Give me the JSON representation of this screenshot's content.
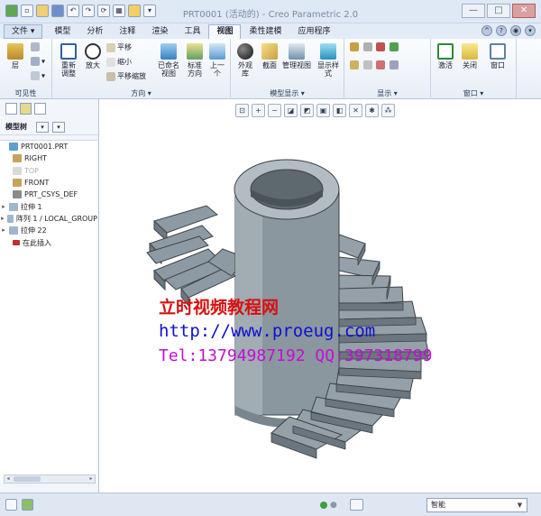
{
  "title_bar": {
    "title": "PRT0001 (活动的) - Creo Parametric 2.0",
    "qat_icons": [
      "new-icon",
      "open-icon",
      "save-icon",
      "undo-icon",
      "redo-icon",
      "regenerate-icon",
      "windows-icon",
      "close-window-icon"
    ],
    "window_buttons": [
      "—",
      "□",
      "✕"
    ]
  },
  "ribbon_tabs": [
    {
      "label": "文件 ▾"
    },
    {
      "label": "模型"
    },
    {
      "label": "分析"
    },
    {
      "label": "注释"
    },
    {
      "label": "渲染"
    },
    {
      "label": "工具"
    },
    {
      "label": "视图"
    },
    {
      "label": "柔性建模"
    },
    {
      "label": "应用程序"
    }
  ],
  "ribbon": {
    "groups": {
      "visibility": "可见性",
      "orientation": "方向 ▾",
      "model_display": "模型显示 ▾",
      "display": "显示 ▾",
      "window": "窗口 ▾"
    },
    "buttons": {
      "layer": "层",
      "refit": "重新\n调整",
      "zoom_in": "放大",
      "pan": "平移",
      "zoom_out": "缩小",
      "pan_zoom": "平移缩放",
      "named_views": "已命名\n视图",
      "standard_orientation": "标准\n方向",
      "previous": "上一\n个",
      "appearance_gallery": "外观\n库",
      "section": "截面",
      "manage_views": "管理视图",
      "display_style": "显示样\n式",
      "activate": "激活",
      "close": "关闭",
      "window": "窗口"
    }
  },
  "model_tree": {
    "header": "模型树",
    "items": [
      {
        "label": "PRT0001.PRT",
        "expander": "",
        "dim": false,
        "icon_color": "#5aa0d0"
      },
      {
        "label": "RIGHT",
        "expander": "",
        "dim": false,
        "icon_color": "#c7a35a"
      },
      {
        "label": "TOP",
        "expander": "",
        "dim": true,
        "icon_color": "#d9d9d9"
      },
      {
        "label": "FRONT",
        "expander": "",
        "dim": false,
        "icon_color": "#c7a35a"
      },
      {
        "label": "PRT_CSYS_DEF",
        "expander": "",
        "dim": false,
        "icon_color": "#8a8a8a"
      },
      {
        "label": "拉伸 1",
        "expander": "▸",
        "dim": false,
        "icon_color": "#9fb5d0"
      },
      {
        "label": "阵列 1 / LOCAL_GROUP",
        "expander": "▸",
        "dim": false,
        "icon_color": "#9fb5d0"
      },
      {
        "label": "拉伸 22",
        "expander": "▸",
        "dim": false,
        "icon_color": "#9fb5d0"
      },
      {
        "label": "在此插入",
        "expander": "",
        "dim": false,
        "icon_color": "#c0302a"
      }
    ]
  },
  "watermark": {
    "line1": "立时视频教程网",
    "line2": "http://www.proeug.com",
    "line3": "Tel:13794987192  QQ:397318799"
  },
  "status_bar": {
    "selection_filter": "智能"
  }
}
